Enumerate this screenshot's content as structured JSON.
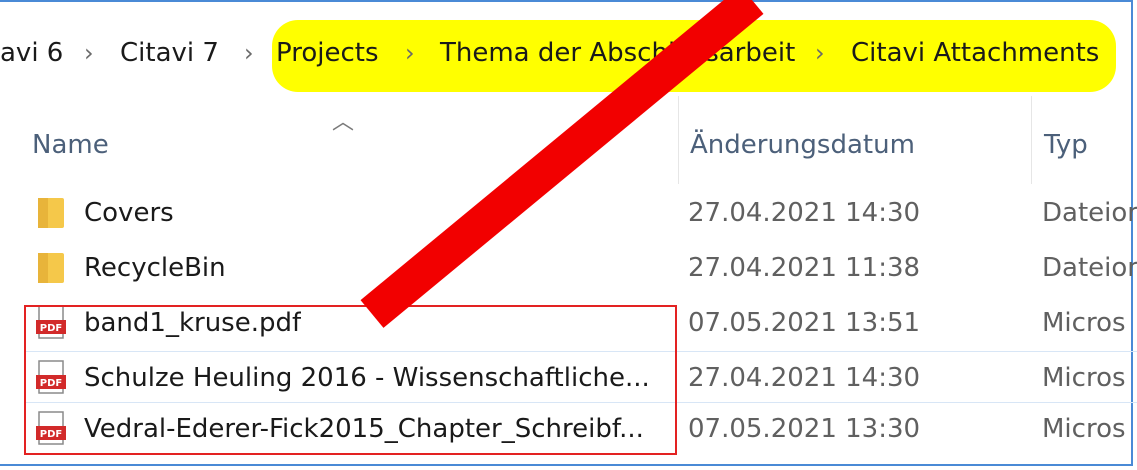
{
  "breadcrumb": {
    "items": [
      "avi 6",
      "Citavi 7",
      "Projects",
      "Thema der Abschlussarbeit",
      "Citavi Attachments"
    ],
    "separator": "›"
  },
  "columns": {
    "name": "Name",
    "date": "Änderungsdatum",
    "type": "Typ"
  },
  "rows": [
    {
      "icon": "folder-icon",
      "name": "Covers",
      "date": "27.04.2021 14:30",
      "type": "Dateior"
    },
    {
      "icon": "folder-icon",
      "name": "RecycleBin",
      "date": "27.04.2021 11:38",
      "type": "Dateior"
    },
    {
      "icon": "pdf-icon",
      "name": "band1_kruse.pdf",
      "date": "07.05.2021 13:51",
      "type": "Micros"
    },
    {
      "icon": "pdf-icon",
      "name": "Schulze Heuling 2016 - Wissenschaftliche...",
      "date": "27.04.2021 14:30",
      "type": "Micros"
    },
    {
      "icon": "pdf-icon",
      "name": "Vedral-Ederer-Fick2015_Chapter_Schreibf...",
      "date": "07.05.2021 13:30",
      "type": "Micros"
    }
  ],
  "pdf_icon_text": "PDF",
  "colors": {
    "highlight": "#ffff00",
    "annotation_red": "#e32222",
    "folder": "#f5c84a",
    "pdf_badge": "#d22a2a"
  }
}
